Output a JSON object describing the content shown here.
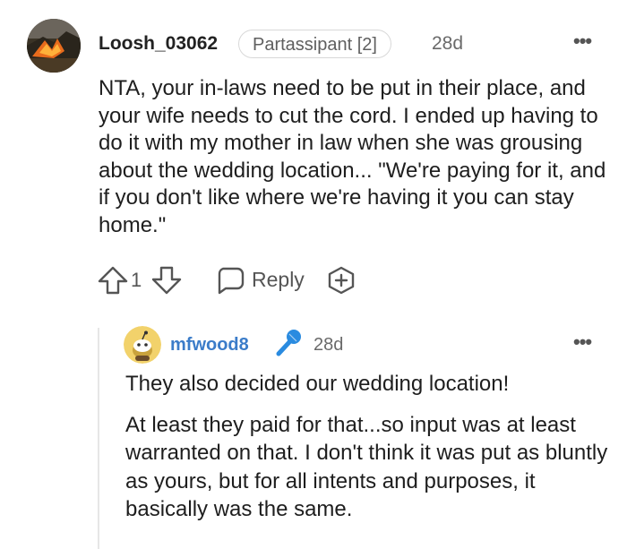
{
  "comment": {
    "username": "Loosh_03062",
    "flair": "Partassipant [2]",
    "time": "28d",
    "more_icon": "more-dots-icon",
    "body": [
      "NTA, your in-laws need to be put in their place, and your wife needs to cut the cord. I ended up having to do it with my mother in law when she was grousing about the wedding location... \"We're paying for it, and if you don't like where we're having it you can stay home.\""
    ],
    "score": "1",
    "reply_label": "Reply",
    "icons": {
      "upvote": "upvote-arrow-icon",
      "downvote": "downvote-arrow-icon",
      "reply": "speech-bubble-icon",
      "award": "award-plus-icon"
    }
  },
  "reply": {
    "username": "mfwood8",
    "badge_icon": "microphone-icon",
    "time": "28d",
    "more_icon": "more-dots-icon",
    "body": [
      "They also decided our wedding location!",
      "At least they paid for that...so input was at least warranted on that. I don't think it was put as bluntly as yours, but for all intents and purposes, it basically was the same."
    ]
  },
  "colors": {
    "username_reply": "#3b7cc9",
    "avatar2_bg": "#f2d26b",
    "mic_blue": "#2a8be0",
    "meta_gray": "#6a6a6a"
  }
}
